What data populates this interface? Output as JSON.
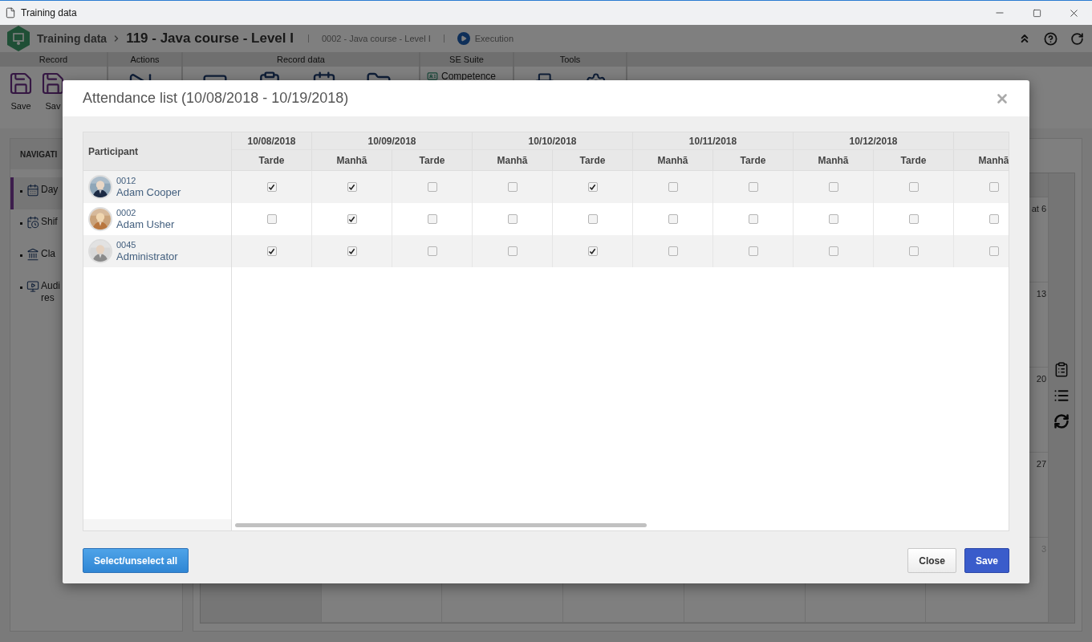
{
  "window": {
    "title": "Training data"
  },
  "header": {
    "app": "Training data",
    "record": "119 - Java course - Level I",
    "subtitle": "0002 - Java course - Level I",
    "status": "Execution"
  },
  "ribbon": [
    {
      "label": "Record",
      "buttons": [
        {
          "label": "Save",
          "kind": "large"
        },
        {
          "label": "Sav",
          "kind": "large"
        }
      ]
    },
    {
      "label": "Actions"
    },
    {
      "label": "Record data"
    },
    {
      "label": "SE Suite",
      "buttons": [
        {
          "label": "Competence",
          "kind": "small"
        }
      ]
    },
    {
      "label": "Tools"
    }
  ],
  "navigation": {
    "title": "NAVIGATI",
    "items": [
      {
        "label": "Day",
        "selected": true
      },
      {
        "label": "Shif",
        "selected": false
      },
      {
        "label": "Cla",
        "selected": false
      },
      {
        "label": "Audi res",
        "selected": false
      }
    ]
  },
  "calendar": {
    "rows": [
      {
        "day": "at 6",
        "outside": false
      },
      {
        "day": "13",
        "outside": false
      },
      {
        "day": "20",
        "outside": false
      },
      {
        "day": "27",
        "outside": false
      },
      {
        "day": "3",
        "outside": true
      }
    ]
  },
  "dialog": {
    "title": "Attendance list (10/08/2018 - 10/19/2018)",
    "participant_header": "Participant",
    "dates": [
      {
        "date": "10/08/2018",
        "sessions": [
          "Tarde"
        ]
      },
      {
        "date": "10/09/2018",
        "sessions": [
          "Manhã",
          "Tarde"
        ]
      },
      {
        "date": "10/10/2018",
        "sessions": [
          "Manhã",
          "Tarde"
        ]
      },
      {
        "date": "10/11/2018",
        "sessions": [
          "Manhã",
          "Tarde"
        ]
      },
      {
        "date": "10/12/2018",
        "sessions": [
          "Manhã",
          "Tarde"
        ]
      },
      {
        "sessions": [
          "Manhã"
        ]
      }
    ],
    "participants": [
      {
        "code": "0012",
        "name": "Adam Cooper",
        "checks": [
          true,
          true,
          false,
          false,
          true,
          false,
          false,
          false,
          false,
          false
        ]
      },
      {
        "code": "0002",
        "name": "Adam Usher",
        "checks": [
          false,
          true,
          false,
          false,
          false,
          false,
          false,
          false,
          false,
          false
        ]
      },
      {
        "code": "0045",
        "name": "Administrator",
        "checks": [
          true,
          true,
          false,
          false,
          true,
          false,
          false,
          false,
          false,
          false
        ]
      }
    ],
    "buttons": {
      "select_all": "Select/unselect all",
      "close": "Close",
      "save": "Save"
    }
  }
}
